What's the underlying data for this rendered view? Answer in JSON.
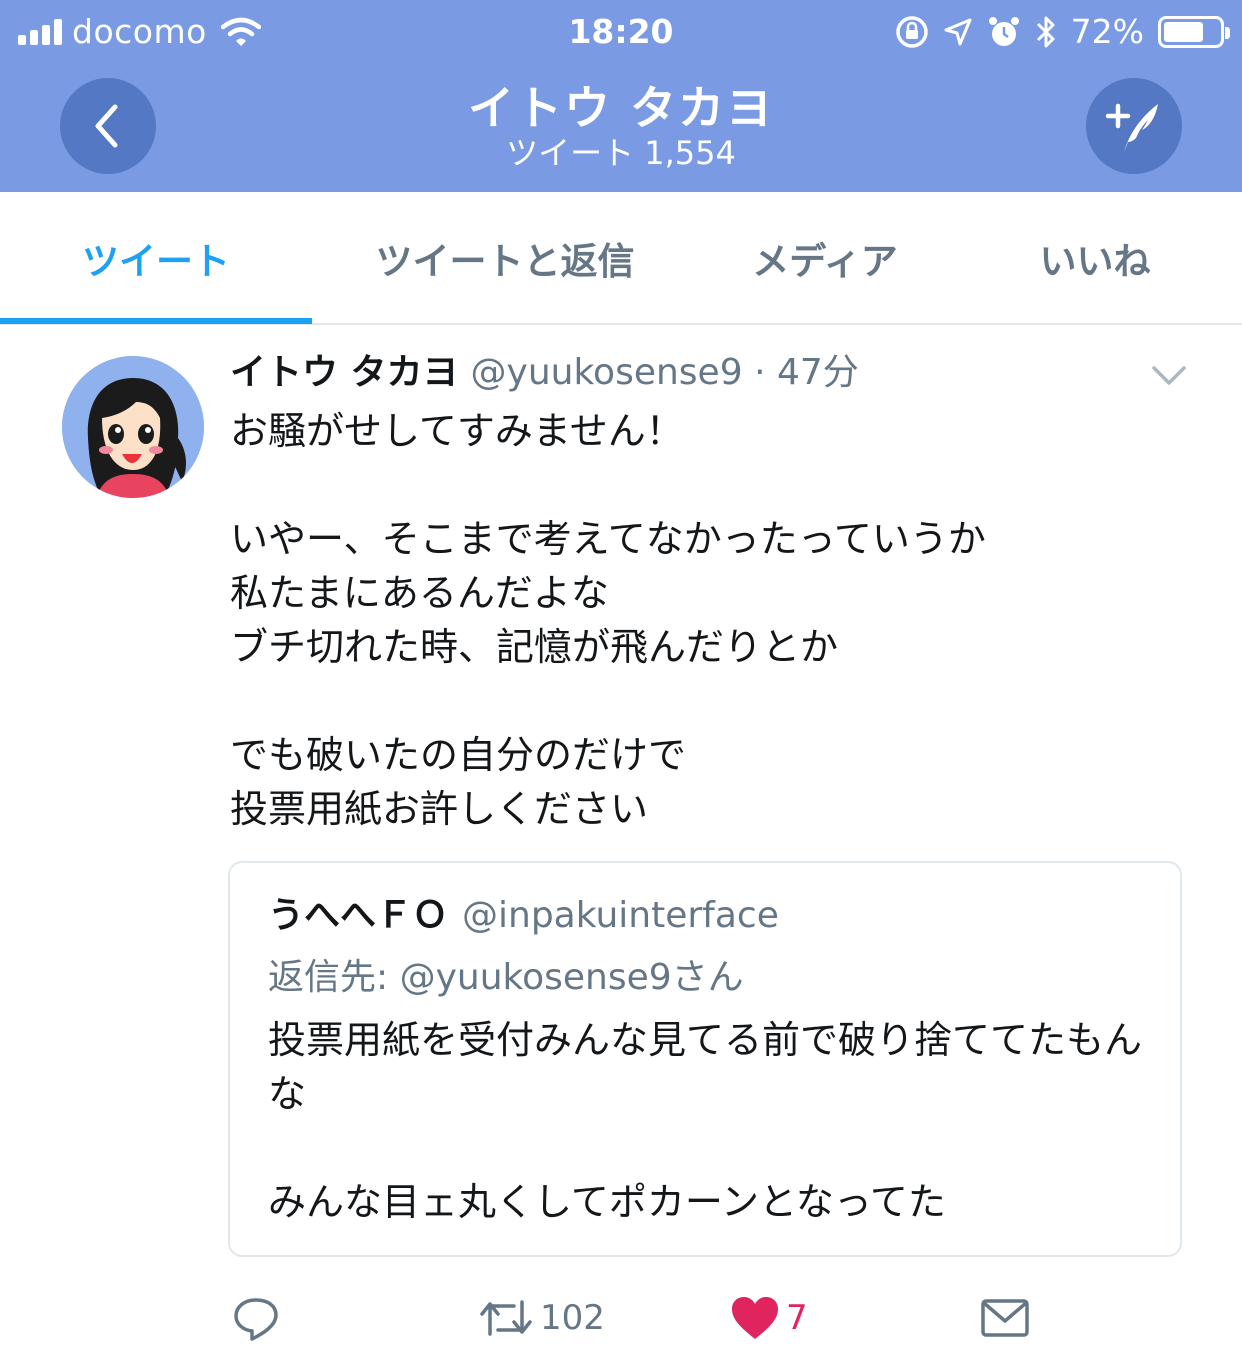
{
  "status_bar": {
    "carrier": "docomo",
    "time": "18:20",
    "battery": "72%",
    "battery_level": 0.72,
    "icons": [
      "signal-icon",
      "wifi-icon",
      "rotation-lock-icon",
      "location-icon",
      "alarm-icon",
      "bluetooth-icon",
      "battery-icon"
    ]
  },
  "header": {
    "title": "イトウ タカヨ",
    "subtitle": "ツイート 1,554",
    "back_icon": "chevron-left-icon",
    "compose_icon": "compose-tweet-icon",
    "background": "#7a9be3",
    "button_color": "#5478c4"
  },
  "tabs": [
    {
      "label": "ツイート",
      "active": true
    },
    {
      "label": "ツイートと返信",
      "active": false
    },
    {
      "label": "メディア",
      "active": false
    },
    {
      "label": "いいね",
      "active": false
    }
  ],
  "tweet": {
    "author_name": "イトウ タカヨ",
    "author_handle": "@yuukosense9",
    "separator": "·",
    "timestamp": "47分",
    "body": "お騒がせしてすみません！\n\nいやー、そこまで考えてなかったっていうか\n私たまにあるんだよな\nブチ切れた時、記憶が飛んだりとか\n\nでも破いたの自分のだけで\n投票用紙お許しください",
    "quoted": {
      "author_name": "うへへＦＯ",
      "author_handle": "@inpakuinterface",
      "reply_to": "返信先: @yuukosense9さん",
      "body": "投票用紙を受付みんな見てる前で破り捨ててたもんな\n\nみんな目ェ丸くしてポカーンとなってた"
    },
    "actions": {
      "reply_count": "",
      "retweet_count": "102",
      "like_count": "7",
      "liked": true
    }
  },
  "colors": {
    "accent": "#1da1f2",
    "like": "#e0245e",
    "muted": "#657786"
  }
}
